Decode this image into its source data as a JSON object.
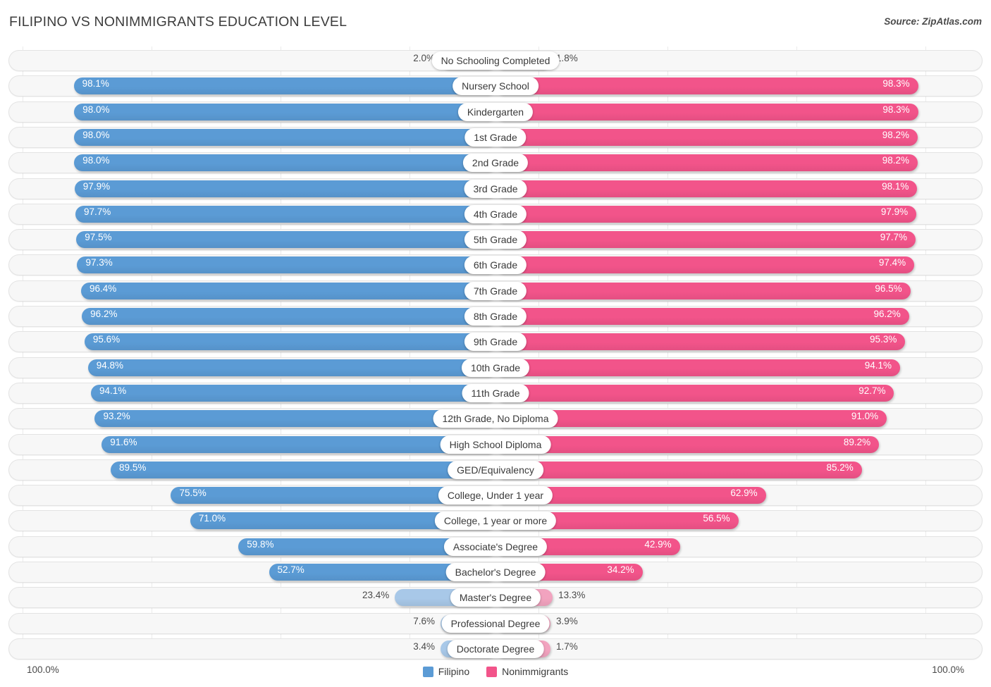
{
  "header": {
    "title": "FILIPINO VS NONIMMIGRANTS EDUCATION LEVEL",
    "source": "Source: ZipAtlas.com"
  },
  "footer": {
    "axis_left": "100.0%",
    "axis_right": "100.0%"
  },
  "legend": {
    "items": [
      {
        "label": "Filipino",
        "color": "#5b9bd5"
      },
      {
        "label": "Nonimmigrants",
        "color": "#f2548a"
      }
    ]
  },
  "colors": {
    "filipino_strong": "#5b9bd5",
    "filipino_light": "#a8c8e8",
    "nonimmigrants_strong": "#f2548a",
    "nonimmigrants_light": "#f2a3bf",
    "track_bg": "#f7f7f7",
    "track_border": "#e3e3e3",
    "gridline": "#ebebeb",
    "text": "#3a3a3a"
  },
  "chart_data": {
    "type": "bar",
    "orientation": "horizontal-diverging",
    "title": "FILIPINO VS NONIMMIGRANTS EDUCATION LEVEL",
    "xlabel": "",
    "ylabel": "",
    "xlim": [
      0,
      100
    ],
    "unit": "%",
    "grid": true,
    "legend_position": "bottom-center",
    "categories": [
      "No Schooling Completed",
      "Nursery School",
      "Kindergarten",
      "1st Grade",
      "2nd Grade",
      "3rd Grade",
      "4th Grade",
      "5th Grade",
      "6th Grade",
      "7th Grade",
      "8th Grade",
      "9th Grade",
      "10th Grade",
      "11th Grade",
      "12th Grade, No Diploma",
      "High School Diploma",
      "GED/Equivalency",
      "College, Under 1 year",
      "College, 1 year or more",
      "Associate's Degree",
      "Bachelor's Degree",
      "Master's Degree",
      "Professional Degree",
      "Doctorate Degree"
    ],
    "series": [
      {
        "name": "Filipino",
        "color": "#5b9bd5",
        "side": "left",
        "values": [
          2.0,
          98.1,
          98.0,
          98.0,
          98.0,
          97.9,
          97.7,
          97.5,
          97.3,
          96.4,
          96.2,
          95.6,
          94.8,
          94.1,
          93.2,
          91.6,
          89.5,
          75.5,
          71.0,
          59.8,
          52.7,
          23.4,
          7.6,
          3.4
        ],
        "labels": [
          "2.0%",
          "98.1%",
          "98.0%",
          "98.0%",
          "98.0%",
          "97.9%",
          "97.7%",
          "97.5%",
          "97.3%",
          "96.4%",
          "96.2%",
          "95.6%",
          "94.8%",
          "94.1%",
          "93.2%",
          "91.6%",
          "89.5%",
          "75.5%",
          "71.0%",
          "59.8%",
          "52.7%",
          "23.4%",
          "7.6%",
          "3.4%"
        ]
      },
      {
        "name": "Nonimmigrants",
        "color": "#f2548a",
        "side": "right",
        "values": [
          1.8,
          98.3,
          98.3,
          98.2,
          98.2,
          98.1,
          97.9,
          97.7,
          97.4,
          96.5,
          96.2,
          95.3,
          94.1,
          92.7,
          91.0,
          89.2,
          85.2,
          62.9,
          56.5,
          42.9,
          34.2,
          13.3,
          3.9,
          1.7
        ],
        "labels": [
          "1.8%",
          "98.3%",
          "98.3%",
          "98.2%",
          "98.2%",
          "98.1%",
          "97.9%",
          "97.7%",
          "97.4%",
          "96.5%",
          "96.2%",
          "95.3%",
          "94.1%",
          "92.7%",
          "91.0%",
          "89.2%",
          "85.2%",
          "62.9%",
          "56.5%",
          "42.9%",
          "34.2%",
          "13.3%",
          "3.9%",
          "1.7%"
        ]
      }
    ]
  }
}
